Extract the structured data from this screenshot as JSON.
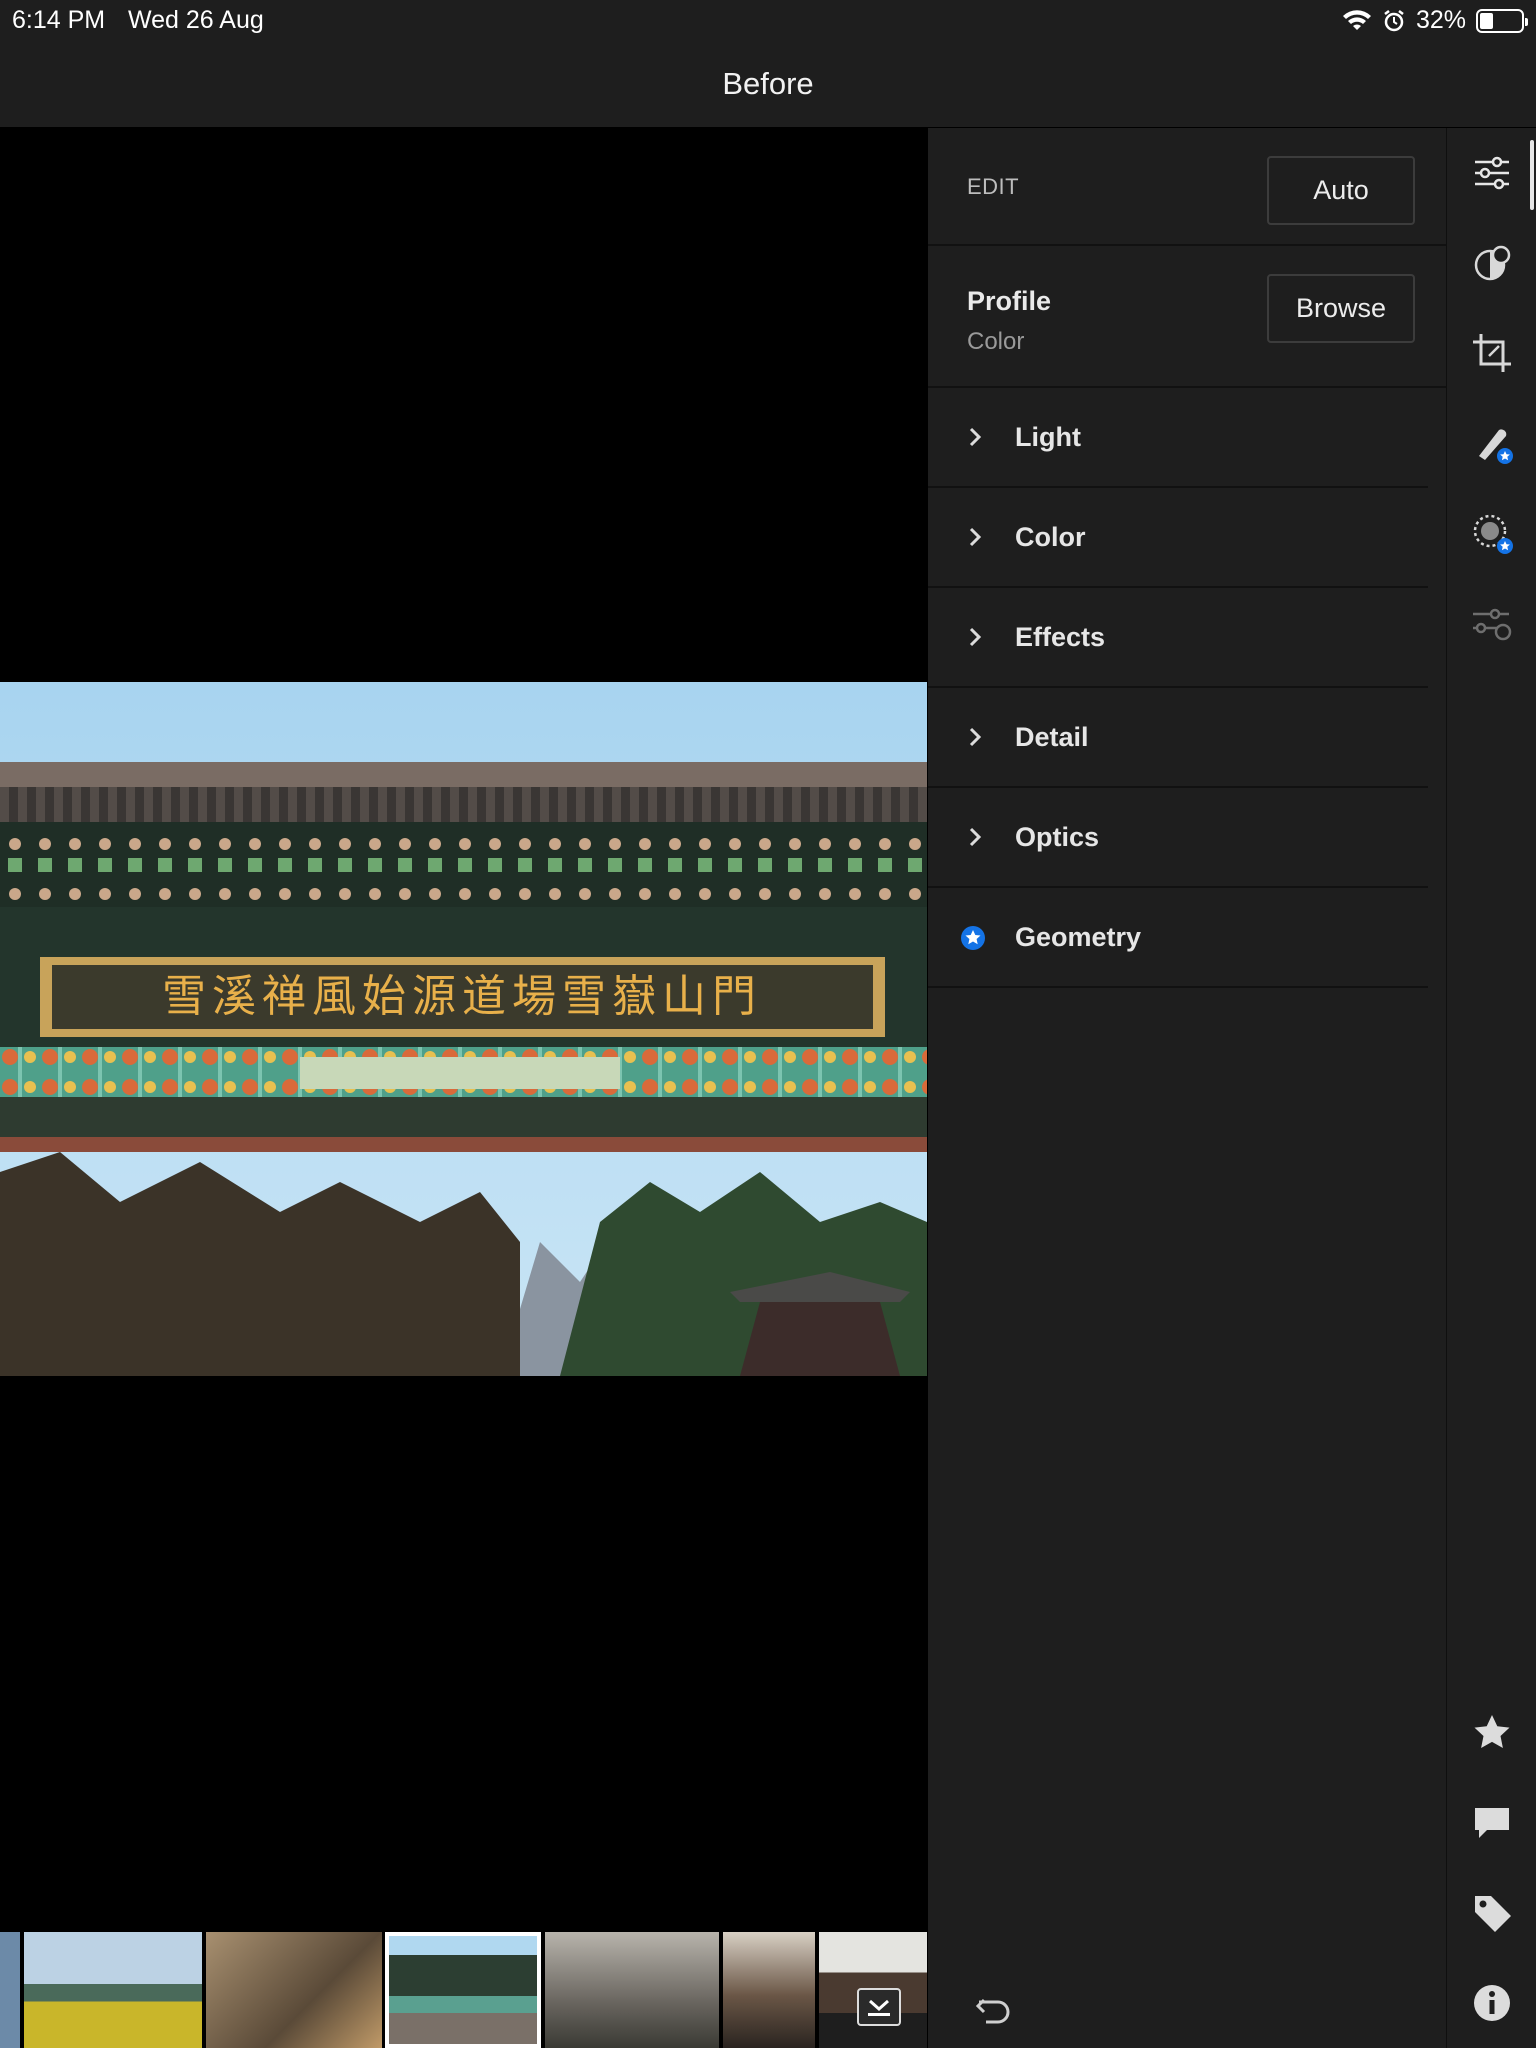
{
  "status": {
    "time": "6:14 PM",
    "date": "Wed 26 Aug",
    "battery_text": "32%",
    "battery_level": 0.32
  },
  "header": {
    "title": "Before"
  },
  "edit_panel": {
    "edit_label": "EDIT",
    "auto_label": "Auto",
    "profile": {
      "label": "Profile",
      "value": "Color",
      "browse_label": "Browse"
    },
    "sections": [
      {
        "label": "Light"
      },
      {
        "label": "Color"
      },
      {
        "label": "Effects"
      },
      {
        "label": "Detail"
      },
      {
        "label": "Optics"
      },
      {
        "label": "Geometry"
      }
    ]
  },
  "photo": {
    "signboard_text": "雪溪禅風始源道場雪嶽山門"
  },
  "toolbar": {
    "tools": [
      "sliders-icon",
      "presets-icon",
      "crop-icon",
      "healing-icon",
      "masking-icon",
      "versions-icon"
    ],
    "bottom": [
      "star-icon",
      "comment-icon",
      "tag-icon",
      "info-icon"
    ]
  },
  "colors": {
    "accent": "#1473e6",
    "panel_bg": "#1e1e1e",
    "canvas_bg": "#000000"
  }
}
